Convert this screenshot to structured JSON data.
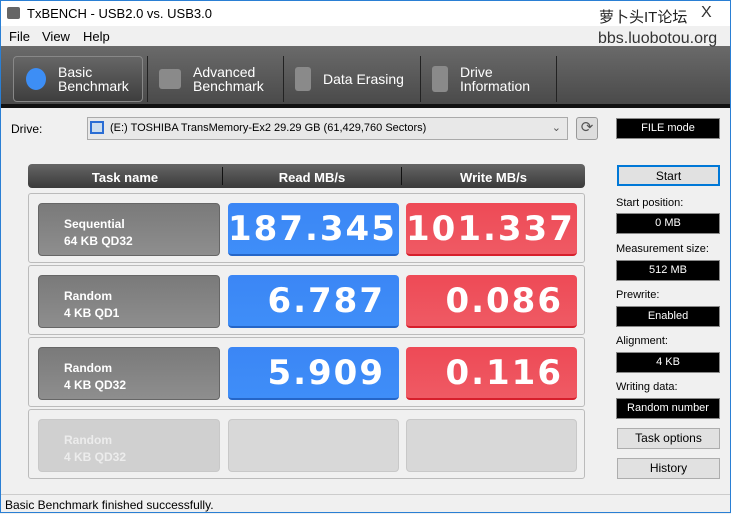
{
  "window": {
    "title": "TxBENCH - USB2.0 vs. USB3.0",
    "watermark_line1": "萝卜头IT论坛",
    "watermark_line2": "bbs.luobotou.org",
    "close": "X"
  },
  "menu": [
    "File",
    "View",
    "Help"
  ],
  "tabs": [
    {
      "line1": "Basic",
      "line2": "Benchmark",
      "icon": "stopwatch-icon",
      "active": true
    },
    {
      "line1": "Advanced",
      "line2": "Benchmark",
      "icon": "bar-chart-icon",
      "active": false
    },
    {
      "line1": "Data Erasing",
      "line2": "",
      "icon": "eraser-zigzag-icon",
      "active": false
    },
    {
      "line1": "Drive",
      "line2": "Information",
      "icon": "drive-info-icon",
      "active": false
    }
  ],
  "drive": {
    "label": "Drive:",
    "value": "(E:) TOSHIBA TransMemory-Ex2  29.29 GB (61,429,760 Sectors)"
  },
  "mode": "FILE mode",
  "table": {
    "headers": [
      "Task name",
      "Read MB/s",
      "Write MB/s"
    ],
    "rows": [
      {
        "name": "Sequential",
        "detail": "64 KB QD32",
        "read": "187.345",
        "write": "101.337"
      },
      {
        "name": "Random",
        "detail": "4 KB QD1",
        "read": "6.787",
        "write": "0.086"
      },
      {
        "name": "Random",
        "detail": "4 KB QD32",
        "read": "5.909",
        "write": "0.116"
      },
      {
        "name": "Random",
        "detail": "4 KB QD32",
        "read": "",
        "write": "",
        "disabled": true
      }
    ]
  },
  "panel": {
    "start": "Start",
    "start_position_label": "Start position:",
    "start_position": "0 MB",
    "measurement_size_label": "Measurement size:",
    "measurement_size": "512 MB",
    "prewrite_label": "Prewrite:",
    "prewrite": "Enabled",
    "alignment_label": "Alignment:",
    "alignment": "4 KB",
    "writing_data_label": "Writing data:",
    "writing_data": "Random number",
    "task_options": "Task options",
    "history": "History"
  },
  "status": "Basic Benchmark finished successfully.",
  "colors": {
    "read": "#3f8ef8",
    "write": "#ef5360",
    "toolbar": "#555555"
  }
}
